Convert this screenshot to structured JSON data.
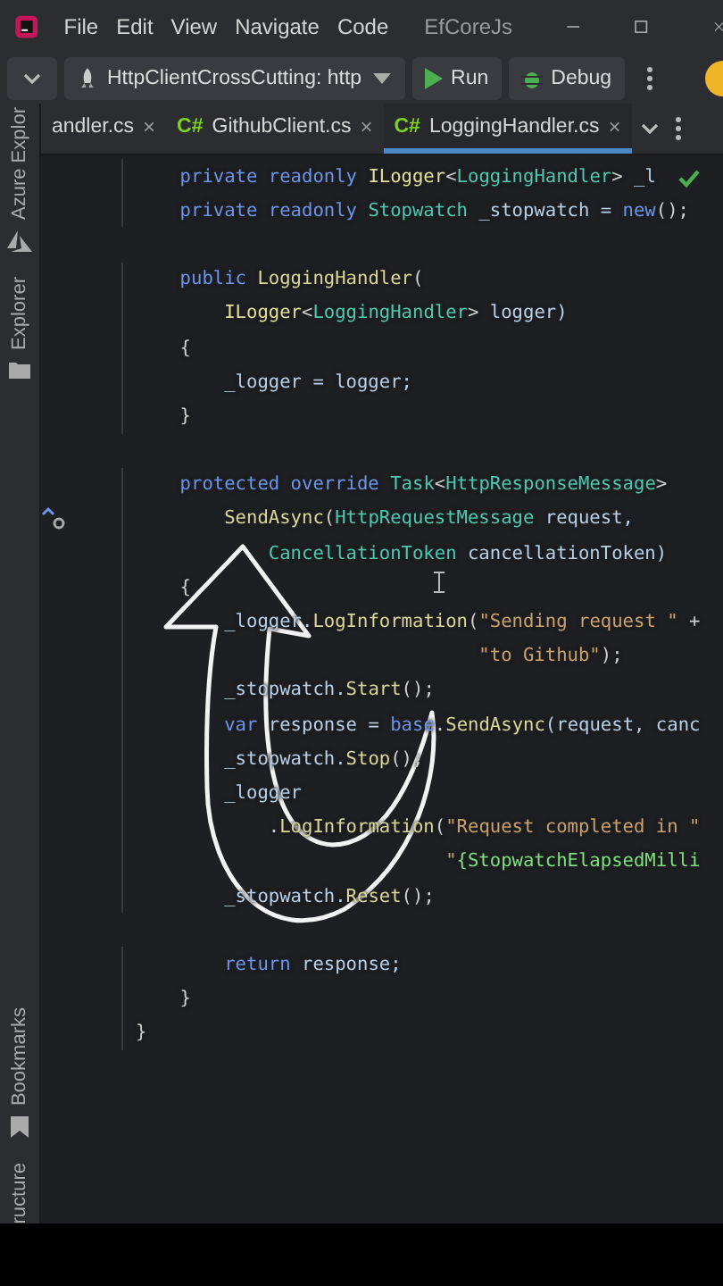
{
  "title_bar": {
    "menus": [
      "File",
      "Edit",
      "View",
      "Navigate",
      "Code"
    ],
    "project": "EfCoreJs"
  },
  "toolbar": {
    "configuration": "HttpClientCrossCutting: http",
    "run": "Run",
    "debug": "Debug"
  },
  "side_panels_top": [
    "Azure Explor",
    "Explorer"
  ],
  "side_panels_bottom": [
    "Bookmarks",
    "ructure"
  ],
  "tabs": [
    {
      "label": "andler.cs",
      "close": "×",
      "selected": false
    },
    {
      "lang": "C#",
      "label": "GithubClient.cs",
      "close": "×",
      "selected": false
    },
    {
      "lang": "C#",
      "label": "LoggingHandler.cs",
      "close": "×",
      "selected": true
    }
  ],
  "editor": {
    "inspection_passed": true,
    "blocks": [
      [
        {
          "tokens": [
            {
              "kind": "keyword",
              "text": "    private readonly "
            },
            {
              "kind": "interface",
              "text": "ILogger"
            },
            {
              "kind": "punctuation",
              "text": "<"
            },
            {
              "kind": "type",
              "text": "LoggingHandler"
            },
            {
              "kind": "punctuation",
              "text": "> "
            },
            {
              "kind": "identifier",
              "text": "_l"
            }
          ]
        },
        {
          "tokens": [
            {
              "kind": "keyword",
              "text": "    private readonly "
            },
            {
              "kind": "type",
              "text": "Stopwatch"
            },
            {
              "kind": "identifier",
              "text": " _stopwatch = "
            },
            {
              "kind": "keyword",
              "text": "new"
            },
            {
              "kind": "punctuation",
              "text": "();"
            }
          ]
        }
      ],
      [
        {
          "tokens": [
            {
              "kind": "keyword",
              "text": "    public "
            },
            {
              "kind": "method",
              "text": "LoggingHandler"
            },
            {
              "kind": "punctuation",
              "text": "("
            }
          ]
        },
        {
          "tokens": [
            {
              "kind": "interface",
              "text": "        ILogger"
            },
            {
              "kind": "punctuation",
              "text": "<"
            },
            {
              "kind": "type",
              "text": "LoggingHandler"
            },
            {
              "kind": "punctuation",
              "text": "> "
            },
            {
              "kind": "identifier",
              "text": "logger)"
            }
          ]
        },
        {
          "tokens": [
            {
              "kind": "punctuation",
              "text": "    {"
            }
          ]
        },
        {
          "tokens": [
            {
              "kind": "identifier",
              "text": "        _logger = logger;"
            }
          ]
        },
        {
          "tokens": [
            {
              "kind": "punctuation",
              "text": "    }"
            }
          ]
        }
      ],
      [
        {
          "tokens": [
            {
              "kind": "keyword",
              "text": "    protected override "
            },
            {
              "kind": "type",
              "text": "Task"
            },
            {
              "kind": "punctuation",
              "text": "<"
            },
            {
              "kind": "type",
              "text": "HttpResponseMessage"
            },
            {
              "kind": "punctuation",
              "text": ">"
            }
          ]
        },
        {
          "override_marker": true,
          "tokens": [
            {
              "kind": "method",
              "text": "        SendAsync"
            },
            {
              "kind": "punctuation",
              "text": "("
            },
            {
              "kind": "type",
              "text": "HttpRequestMessage"
            },
            {
              "kind": "identifier",
              "text": " request,"
            }
          ]
        },
        {
          "tokens": [
            {
              "kind": "type",
              "text": "            CancellationToken"
            },
            {
              "kind": "identifier",
              "text": " cancellationToken)"
            }
          ]
        },
        {
          "tokens": [
            {
              "kind": "punctuation",
              "text": "    {"
            }
          ]
        },
        {
          "tokens": [
            {
              "kind": "identifier",
              "text": "        _logger."
            },
            {
              "kind": "method",
              "text": "LogInformation"
            },
            {
              "kind": "punctuation",
              "text": "("
            },
            {
              "kind": "string",
              "text": "\"Sending request \""
            },
            {
              "kind": "punctuation",
              "text": " +"
            }
          ]
        },
        {
          "tokens": [
            {
              "kind": "string",
              "text": "                               \"to Github\""
            },
            {
              "kind": "punctuation",
              "text": ");"
            }
          ]
        },
        {
          "tokens": [
            {
              "kind": "identifier",
              "text": "        _stopwatch."
            },
            {
              "kind": "method",
              "text": "Start"
            },
            {
              "kind": "punctuation",
              "text": "();"
            }
          ]
        },
        {
          "tokens": [
            {
              "kind": "keyword",
              "text": "        var"
            },
            {
              "kind": "identifier",
              "text": " response = "
            },
            {
              "kind": "keyword",
              "text": "base"
            },
            {
              "kind": "identifier",
              "text": "."
            },
            {
              "kind": "method",
              "text": "SendAsync"
            },
            {
              "kind": "identifier",
              "text": "(request, canc"
            }
          ]
        },
        {
          "tokens": [
            {
              "kind": "identifier",
              "text": "        _stopwatch."
            },
            {
              "kind": "method",
              "text": "Stop"
            },
            {
              "kind": "punctuation",
              "text": "();"
            }
          ]
        },
        {
          "tokens": [
            {
              "kind": "identifier",
              "text": "        _logger"
            }
          ]
        },
        {
          "tokens": [
            {
              "kind": "punctuation",
              "text": "            ."
            },
            {
              "kind": "method",
              "text": "LogInformation"
            },
            {
              "kind": "punctuation",
              "text": "("
            },
            {
              "kind": "string",
              "text": "\"Request completed in \""
            }
          ]
        },
        {
          "tokens": [
            {
              "kind": "string",
              "text": "                            \""
            },
            {
              "kind": "interpolation",
              "text": "{StopwatchElapsedMilli"
            }
          ]
        },
        {
          "tokens": [
            {
              "kind": "identifier",
              "text": "        _stopwatch."
            },
            {
              "kind": "method",
              "text": "Reset"
            },
            {
              "kind": "punctuation",
              "text": "();"
            }
          ]
        }
      ],
      [
        {
          "tokens": [
            {
              "kind": "keyword",
              "text": "        return"
            },
            {
              "kind": "identifier",
              "text": " response;"
            }
          ]
        },
        {
          "tokens": [
            {
              "kind": "punctuation",
              "text": "    }"
            }
          ]
        },
        {
          "tokens": [
            {
              "kind": "punctuation",
              "text": "}"
            }
          ]
        }
      ]
    ]
  }
}
